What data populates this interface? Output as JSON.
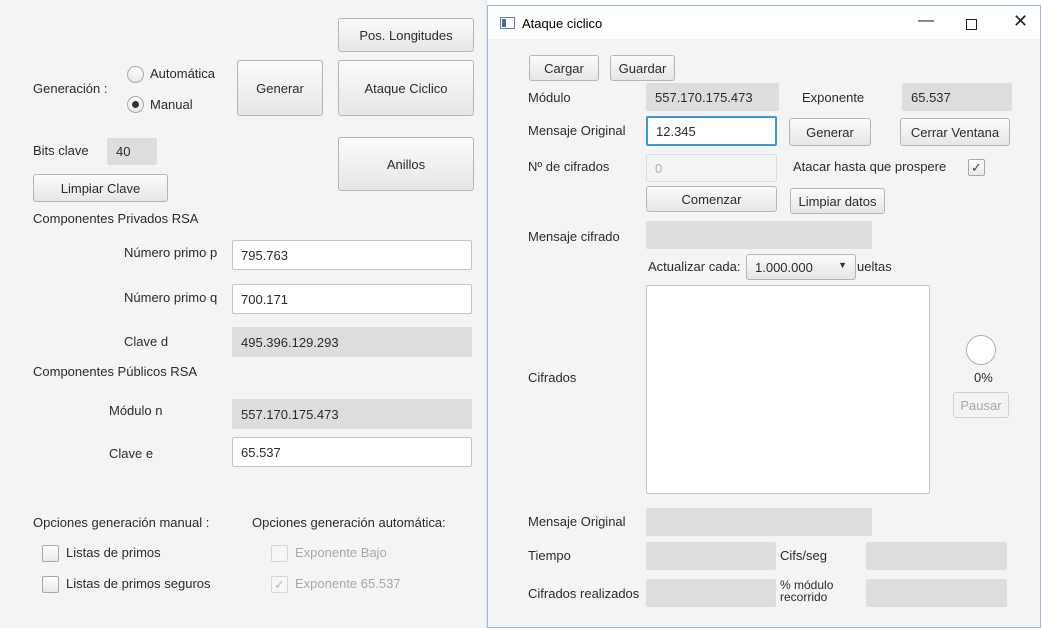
{
  "main": {
    "pos_longitudes_button": "Pos. Longitudes",
    "generacion_label": "Generación :",
    "radio_automatica": "Automática",
    "radio_manual": "Manual",
    "generar_button": "Generar",
    "ataque_ciclico_button": "Ataque Ciclico",
    "bits_clave_label": "Bits clave",
    "bits_clave_value": "40",
    "anillos_button": "Anillos",
    "limpiar_clave_button": "Limpiar Clave",
    "privados_header": "Componentes Privados RSA",
    "primo_p_label": "Número primo p",
    "primo_p_value": "795.763",
    "primo_q_label": "Número primo q",
    "primo_q_value": "700.171",
    "clave_d_label": "Clave d",
    "clave_d_value": "495.396.129.293",
    "publicos_header": "Componentes Públicos RSA",
    "modulo_n_label": "Módulo n",
    "modulo_n_value": "557.170.175.473",
    "clave_e_label": "Clave e",
    "clave_e_value": "65.537",
    "opciones_manual_label": "Opciones generación manual :",
    "opciones_auto_label": "Opciones generación automática:",
    "listas_primos": "Listas de primos",
    "listas_primos_seguros": "Listas de primos seguros",
    "exponente_bajo": "Exponente Bajo",
    "exponente_65537": "Exponente 65.537"
  },
  "dialog": {
    "title": "Ataque ciclico",
    "cargar_button": "Cargar",
    "guardar_button": "Guardar",
    "modulo_label": "Módulo",
    "modulo_value": "557.170.175.473",
    "exponente_label": "Exponente",
    "exponente_value": "65.537",
    "mensaje_original_label": "Mensaje Original",
    "mensaje_original_value": "12.345",
    "generar_button": "Generar",
    "cerrar_ventana_button": "Cerrar Ventana",
    "num_cifrados_label": "Nº de cifrados",
    "num_cifrados_value": "0",
    "atacar_label": "Atacar hasta que prospere",
    "comenzar_button": "Comenzar",
    "limpiar_datos_button": "Limpiar datos",
    "mensaje_cifrado_label": "Mensaje cifrado",
    "actualizar_label": "Actualizar cada:",
    "actualizar_value": "1.000.000",
    "vueltas_label": "ueltas",
    "cifrados_label": "Cifrados",
    "progress_text": "0%",
    "progress_fraction": 0,
    "pausar_button": "Pausar",
    "mensaje_original2_label": "Mensaje Original",
    "tiempo_label": "Tiempo",
    "cifs_seg_label": "Cifs/seg",
    "cifrados_realizados_label": "Cifrados realizados",
    "modulo_recorrido_label_1": "% módulo",
    "modulo_recorrido_label_2": "recorrido"
  }
}
